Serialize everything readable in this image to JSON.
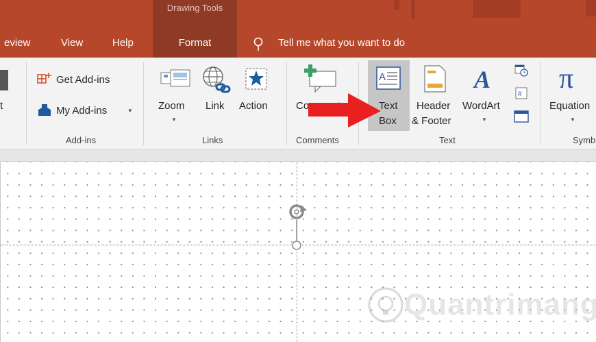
{
  "contextual_header": "Drawing Tools",
  "tabs": [
    {
      "label": "eview"
    },
    {
      "label": "View"
    },
    {
      "label": "Help"
    },
    {
      "label": "Format"
    }
  ],
  "tell_me": "Tell me what you want to do",
  "ribbon": {
    "partial_left_label": "t",
    "addins": {
      "get_addins": "Get Add-ins",
      "my_addins": "My Add-ins",
      "group_label": "Add-ins"
    },
    "links": {
      "zoom": "Zoom",
      "link": "Link",
      "action": "Action",
      "group_label": "Links"
    },
    "comments": {
      "comment": "Comment",
      "group_label": "Comments"
    },
    "text": {
      "text_box_line1": "Text",
      "text_box_line2": "Box",
      "header_line1": "Header",
      "header_line2": "& Footer",
      "wordart": "WordArt",
      "group_label": "Text"
    },
    "symbols": {
      "equation": "Equation",
      "group_label": "Symb"
    }
  },
  "watermark": "Quantrimang",
  "colors": {
    "accent": "#b7472a",
    "context": "#8f3a24",
    "arrow": "#e8201f",
    "icon_blue": "#2b579a"
  }
}
